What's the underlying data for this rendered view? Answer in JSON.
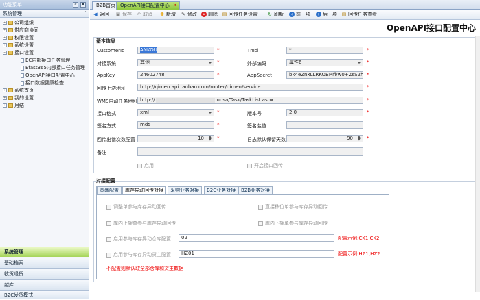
{
  "sidebar": {
    "header": "功能菜单",
    "system": "系统管理",
    "tree": [
      "公司组织",
      "供应商协同",
      "权限设置",
      "系统设置",
      "接口设置",
      "EC内部接口任务管理",
      "Efast365内部接口任务管理",
      "OpenAPI接口配置中心",
      "接口数据健康检查",
      "系统首页",
      "我的设置",
      "月结"
    ],
    "nav": [
      "系统管理",
      "基础档案",
      "收货退货",
      "越库",
      "B2C发货模式"
    ]
  },
  "tabs": [
    "B2B首页",
    "OpenAPI接口配置中心"
  ],
  "toolbar": {
    "back": "返回",
    "save": "保存",
    "cancel": "取消",
    "new": "新增",
    "edit": "修改",
    "delete": "删除",
    "callback_settings": "回传任务设置",
    "refresh": "刷新",
    "prev": "前一项",
    "next": "后一项",
    "callback_view": "回传任务查看"
  },
  "page_title": "OpenAPI接口配置中心",
  "basic": {
    "section": "基本信息",
    "customer_id_label": "CustomerId",
    "customer_id": "ANKOU",
    "tnid_label": "TnId",
    "tnid": "*",
    "peer_label": "对接系统",
    "peer": "其他",
    "ext_code_label": "外部编码",
    "ext_code": "属性6",
    "appkey_label": "AppKey",
    "appkey": "24602748",
    "appsecret_label": "AppSecret",
    "appsecret": "bk4eZnxLLRKOBMfi/w0+ZsS2hyUC",
    "callback_url_label": "回传上游地址",
    "callback_url": "http://qimen.api.taobao.com/router/qimen/service",
    "wms_url_label": "WMS自动任务地址",
    "wms_url_a": "http://",
    "wms_url_b": "unsa/Task/TaskList.aspx",
    "format_label": "接口格式",
    "format": "xml",
    "version_label": "版本号",
    "version": "2.0",
    "sign_label": "签名方式",
    "sign": "md5",
    "salt_label": "签名盐值",
    "salt": "",
    "retry_label": "回传出错次数配置",
    "retry": "10",
    "log_label": "日志默认保留天数",
    "log": "90",
    "remark_label": "备注",
    "enable": "启用",
    "enable_callback": "开启接口回传"
  },
  "config": {
    "section": "对接配置",
    "tabs": [
      "基础配置",
      "库存异动回传对接",
      "采购业务对接",
      "B2C业务对接",
      "B2B业务对接"
    ],
    "c1": "调整单参与库存异动回传",
    "c2": "直接移位单参与库存异动回传",
    "c3": "库内上架单参与库存异动回传",
    "c4": "库内下架单参与库存异动回传",
    "c5": "启用参与库存异动仓库配置",
    "c5v": "02",
    "c5ex": "配置示例:CK1,CK2",
    "c6": "启用参与库存异动货主配置",
    "c6v": "HZ01",
    "c6ex": "配置示例:HZ1,HZ2",
    "warn": "不配置则默认取全部仓库和货主数据"
  }
}
